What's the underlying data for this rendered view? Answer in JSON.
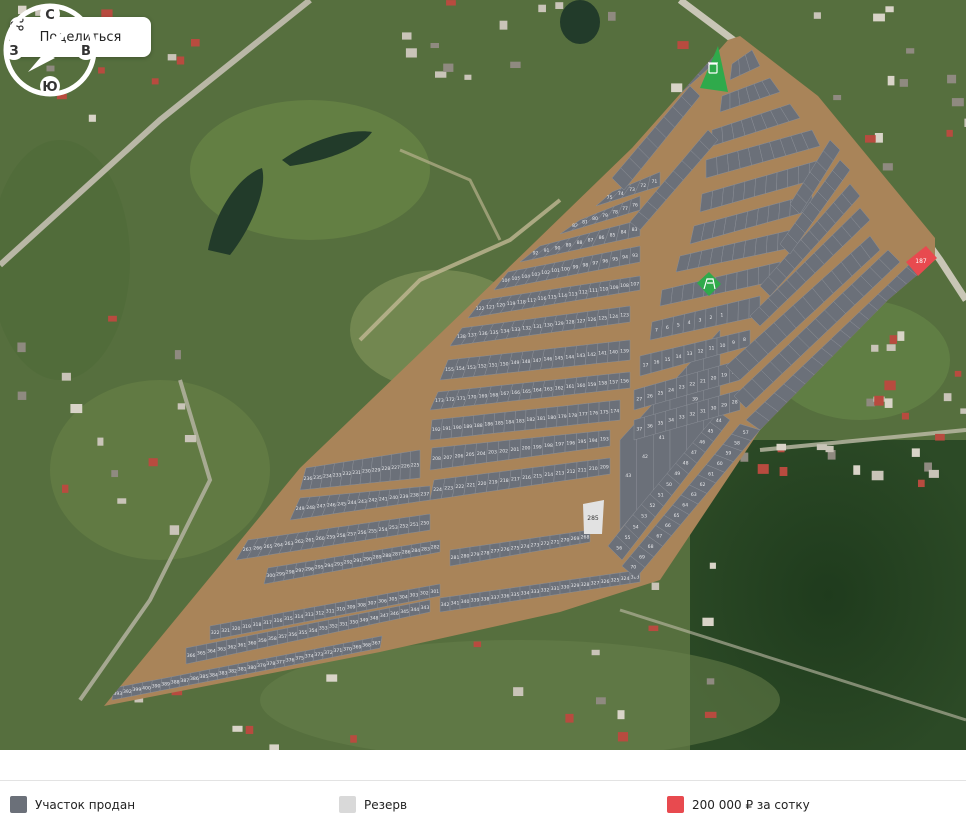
{
  "share": {
    "label": "Поделиться",
    "icon": "share-icon"
  },
  "compass": {
    "north": "С",
    "south": "Ю",
    "east": "В",
    "west": "З",
    "icon": "compass-icon"
  },
  "legend": [
    {
      "label": "Участок продан",
      "color": "#6b7079"
    },
    {
      "label": "Резерв",
      "color": "#d9d9d9"
    },
    {
      "label": "200 000 ₽ за сотку",
      "color": "#e84a4f"
    }
  ],
  "map": {
    "colors": {
      "sold": "#6b7079",
      "road": "#a98459",
      "reserve": "#e2e2e2",
      "price": "#e84a4f",
      "amenity": "#2faa4b"
    },
    "reserve_plot": "285",
    "price_plot": "187",
    "amenities": [
      "trash-bin-icon",
      "playground-icon"
    ],
    "plot_labels": [
      "393",
      "392",
      "399",
      "400",
      "390",
      "389",
      "388",
      "387",
      "386",
      "385",
      "384",
      "383",
      "382",
      "381",
      "380",
      "379",
      "378",
      "377",
      "376",
      "375",
      "374",
      "373",
      "372",
      "371",
      "370",
      "369",
      "368",
      "367",
      "366",
      "365",
      "364",
      "363",
      "362",
      "361",
      "360",
      "359",
      "358",
      "357",
      "356",
      "355",
      "354",
      "353",
      "352",
      "351",
      "350",
      "349",
      "348",
      "347",
      "346",
      "345",
      "344",
      "343",
      "342",
      "341",
      "340",
      "339",
      "338",
      "337",
      "336",
      "335",
      "334",
      "333",
      "332",
      "331",
      "330",
      "329",
      "328",
      "327",
      "326",
      "325",
      "324",
      "323",
      "322",
      "321",
      "320",
      "319",
      "318",
      "317",
      "316",
      "315",
      "314",
      "313",
      "312",
      "311",
      "310",
      "309",
      "308",
      "307",
      "306",
      "305",
      "304",
      "303",
      "302",
      "301",
      "300",
      "299",
      "298",
      "297",
      "296",
      "295",
      "294",
      "293",
      "292",
      "291",
      "290",
      "289",
      "288",
      "287",
      "286",
      "284",
      "283",
      "282",
      "281",
      "280",
      "279",
      "278",
      "277",
      "276",
      "275",
      "274",
      "273",
      "272",
      "271",
      "270",
      "269",
      "268",
      "267",
      "266",
      "265",
      "264",
      "263",
      "262",
      "261",
      "260",
      "259",
      "258",
      "257",
      "256",
      "255",
      "254",
      "253",
      "252",
      "251",
      "250",
      "249",
      "248",
      "247",
      "246",
      "245",
      "244",
      "243",
      "242",
      "241",
      "240",
      "239",
      "238",
      "237",
      "236",
      "235",
      "234",
      "233",
      "232",
      "231",
      "230",
      "229",
      "228",
      "227",
      "226",
      "225",
      "224",
      "223",
      "222",
      "221",
      "220",
      "219",
      "218",
      "217",
      "216",
      "215",
      "214",
      "213",
      "212",
      "211",
      "210",
      "209",
      "208",
      "207",
      "206",
      "205",
      "204",
      "203",
      "202",
      "201",
      "200",
      "199",
      "198",
      "197",
      "196",
      "195",
      "194",
      "193",
      "192",
      "191",
      "190",
      "189",
      "188",
      "186",
      "185",
      "184",
      "183",
      "182",
      "181",
      "180",
      "179",
      "178",
      "177",
      "176",
      "175",
      "174",
      "173",
      "172",
      "171",
      "170",
      "169",
      "168",
      "167",
      "166",
      "165",
      "164",
      "163",
      "162",
      "161",
      "160",
      "159",
      "158",
      "157",
      "156",
      "155",
      "154",
      "153",
      "152",
      "151",
      "150",
      "149",
      "148",
      "147",
      "146",
      "145",
      "144",
      "143",
      "142",
      "141",
      "140",
      "139",
      "138",
      "137",
      "136",
      "135",
      "134",
      "133",
      "132",
      "131",
      "130",
      "129",
      "128",
      "127",
      "126",
      "125",
      "124",
      "123",
      "122",
      "121",
      "120",
      "119",
      "118",
      "117",
      "116",
      "115",
      "114",
      "113",
      "112",
      "111",
      "110",
      "109",
      "108",
      "107",
      "106",
      "105",
      "104",
      "103",
      "102",
      "101",
      "100",
      "99",
      "98",
      "97",
      "96",
      "95",
      "94",
      "93",
      "92",
      "91",
      "90",
      "89",
      "88",
      "87",
      "86",
      "85",
      "84",
      "83",
      "82",
      "81",
      "80",
      "79",
      "78",
      "77",
      "76",
      "75",
      "74",
      "73",
      "72",
      "71",
      "70",
      "69",
      "68",
      "67",
      "66",
      "65",
      "64",
      "63",
      "62",
      "61",
      "60",
      "59",
      "58",
      "57",
      "56",
      "55",
      "54",
      "53",
      "52",
      "51",
      "50",
      "49",
      "48",
      "47",
      "46",
      "45",
      "44",
      "43",
      "42",
      "41",
      "40",
      "39",
      "38",
      "37",
      "36",
      "35",
      "34",
      "33",
      "32",
      "31",
      "30",
      "29",
      "28",
      "27",
      "26",
      "25",
      "24",
      "23",
      "22",
      "21",
      "20",
      "19",
      "18",
      "17",
      "16",
      "15",
      "14",
      "13",
      "12",
      "11",
      "10",
      "9",
      "8",
      "7",
      "6",
      "5",
      "4",
      "3",
      "2",
      "1"
    ]
  }
}
